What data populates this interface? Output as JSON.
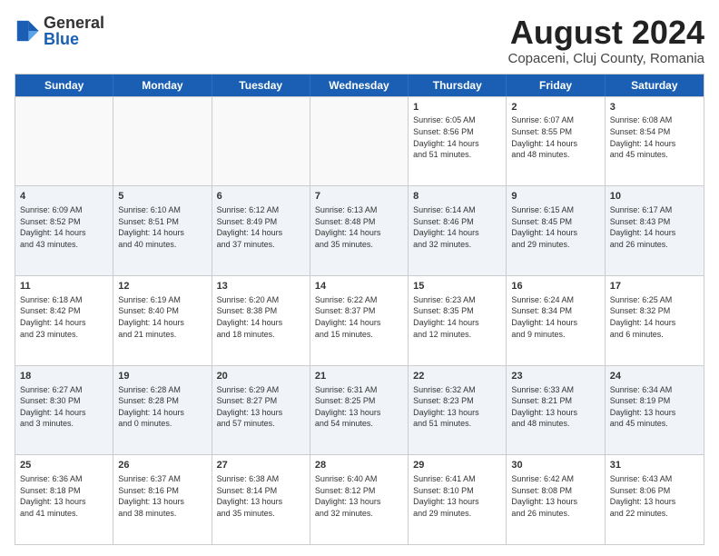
{
  "logo": {
    "general": "General",
    "blue": "Blue"
  },
  "title": "August 2024",
  "subtitle": "Copaceni, Cluj County, Romania",
  "header_days": [
    "Sunday",
    "Monday",
    "Tuesday",
    "Wednesday",
    "Thursday",
    "Friday",
    "Saturday"
  ],
  "rows": [
    [
      {
        "day": "",
        "info": "",
        "empty": true
      },
      {
        "day": "",
        "info": "",
        "empty": true
      },
      {
        "day": "",
        "info": "",
        "empty": true
      },
      {
        "day": "",
        "info": "",
        "empty": true
      },
      {
        "day": "1",
        "info": "Sunrise: 6:05 AM\nSunset: 8:56 PM\nDaylight: 14 hours\nand 51 minutes."
      },
      {
        "day": "2",
        "info": "Sunrise: 6:07 AM\nSunset: 8:55 PM\nDaylight: 14 hours\nand 48 minutes."
      },
      {
        "day": "3",
        "info": "Sunrise: 6:08 AM\nSunset: 8:54 PM\nDaylight: 14 hours\nand 45 minutes."
      }
    ],
    [
      {
        "day": "4",
        "info": "Sunrise: 6:09 AM\nSunset: 8:52 PM\nDaylight: 14 hours\nand 43 minutes."
      },
      {
        "day": "5",
        "info": "Sunrise: 6:10 AM\nSunset: 8:51 PM\nDaylight: 14 hours\nand 40 minutes."
      },
      {
        "day": "6",
        "info": "Sunrise: 6:12 AM\nSunset: 8:49 PM\nDaylight: 14 hours\nand 37 minutes."
      },
      {
        "day": "7",
        "info": "Sunrise: 6:13 AM\nSunset: 8:48 PM\nDaylight: 14 hours\nand 35 minutes."
      },
      {
        "day": "8",
        "info": "Sunrise: 6:14 AM\nSunset: 8:46 PM\nDaylight: 14 hours\nand 32 minutes."
      },
      {
        "day": "9",
        "info": "Sunrise: 6:15 AM\nSunset: 8:45 PM\nDaylight: 14 hours\nand 29 minutes."
      },
      {
        "day": "10",
        "info": "Sunrise: 6:17 AM\nSunset: 8:43 PM\nDaylight: 14 hours\nand 26 minutes."
      }
    ],
    [
      {
        "day": "11",
        "info": "Sunrise: 6:18 AM\nSunset: 8:42 PM\nDaylight: 14 hours\nand 23 minutes."
      },
      {
        "day": "12",
        "info": "Sunrise: 6:19 AM\nSunset: 8:40 PM\nDaylight: 14 hours\nand 21 minutes."
      },
      {
        "day": "13",
        "info": "Sunrise: 6:20 AM\nSunset: 8:38 PM\nDaylight: 14 hours\nand 18 minutes."
      },
      {
        "day": "14",
        "info": "Sunrise: 6:22 AM\nSunset: 8:37 PM\nDaylight: 14 hours\nand 15 minutes."
      },
      {
        "day": "15",
        "info": "Sunrise: 6:23 AM\nSunset: 8:35 PM\nDaylight: 14 hours\nand 12 minutes."
      },
      {
        "day": "16",
        "info": "Sunrise: 6:24 AM\nSunset: 8:34 PM\nDaylight: 14 hours\nand 9 minutes."
      },
      {
        "day": "17",
        "info": "Sunrise: 6:25 AM\nSunset: 8:32 PM\nDaylight: 14 hours\nand 6 minutes."
      }
    ],
    [
      {
        "day": "18",
        "info": "Sunrise: 6:27 AM\nSunset: 8:30 PM\nDaylight: 14 hours\nand 3 minutes."
      },
      {
        "day": "19",
        "info": "Sunrise: 6:28 AM\nSunset: 8:28 PM\nDaylight: 14 hours\nand 0 minutes."
      },
      {
        "day": "20",
        "info": "Sunrise: 6:29 AM\nSunset: 8:27 PM\nDaylight: 13 hours\nand 57 minutes."
      },
      {
        "day": "21",
        "info": "Sunrise: 6:31 AM\nSunset: 8:25 PM\nDaylight: 13 hours\nand 54 minutes."
      },
      {
        "day": "22",
        "info": "Sunrise: 6:32 AM\nSunset: 8:23 PM\nDaylight: 13 hours\nand 51 minutes."
      },
      {
        "day": "23",
        "info": "Sunrise: 6:33 AM\nSunset: 8:21 PM\nDaylight: 13 hours\nand 48 minutes."
      },
      {
        "day": "24",
        "info": "Sunrise: 6:34 AM\nSunset: 8:19 PM\nDaylight: 13 hours\nand 45 minutes."
      }
    ],
    [
      {
        "day": "25",
        "info": "Sunrise: 6:36 AM\nSunset: 8:18 PM\nDaylight: 13 hours\nand 41 minutes."
      },
      {
        "day": "26",
        "info": "Sunrise: 6:37 AM\nSunset: 8:16 PM\nDaylight: 13 hours\nand 38 minutes."
      },
      {
        "day": "27",
        "info": "Sunrise: 6:38 AM\nSunset: 8:14 PM\nDaylight: 13 hours\nand 35 minutes."
      },
      {
        "day": "28",
        "info": "Sunrise: 6:40 AM\nSunset: 8:12 PM\nDaylight: 13 hours\nand 32 minutes."
      },
      {
        "day": "29",
        "info": "Sunrise: 6:41 AM\nSunset: 8:10 PM\nDaylight: 13 hours\nand 29 minutes."
      },
      {
        "day": "30",
        "info": "Sunrise: 6:42 AM\nSunset: 8:08 PM\nDaylight: 13 hours\nand 26 minutes."
      },
      {
        "day": "31",
        "info": "Sunrise: 6:43 AM\nSunset: 8:06 PM\nDaylight: 13 hours\nand 22 minutes."
      }
    ]
  ]
}
